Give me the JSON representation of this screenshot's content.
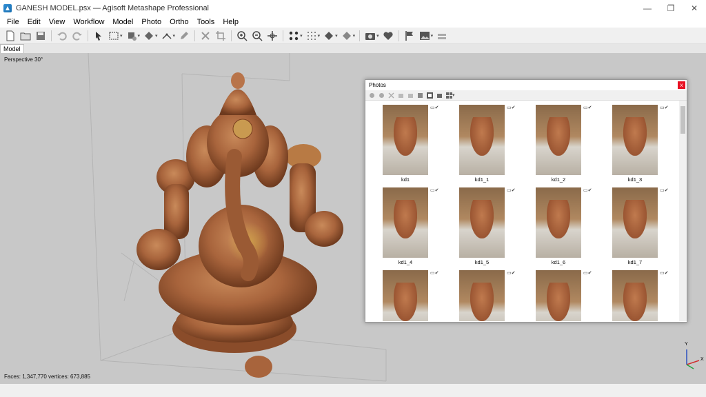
{
  "window": {
    "title": "GANESH MODEL.psx — Agisoft Metashape Professional",
    "controls": [
      "—",
      "❐",
      "✕"
    ]
  },
  "menu": [
    "File",
    "Edit",
    "View",
    "Workflow",
    "Model",
    "Photo",
    "Ortho",
    "Tools",
    "Help"
  ],
  "toolbar": {
    "icons": [
      "new-file-icon",
      "open-folder-icon",
      "save-icon",
      "undo-icon",
      "redo-icon",
      "pointer-icon",
      "rect-select-icon",
      "paint-icon",
      "fill-icon",
      "ruler-icon",
      "pencil-icon",
      "delete-icon",
      "crop-icon",
      "zoom-in-icon",
      "zoom-out-icon",
      "navigate-icon",
      "points-icon",
      "dots-grid-icon",
      "shape-icon",
      "shape-alt-icon",
      "camera-icon",
      "heart-icon",
      "flag-icon",
      "photo-icon",
      "stack-icon"
    ]
  },
  "tabs": {
    "model": "Model"
  },
  "viewport": {
    "view_label": "Perspective 30°",
    "status": "Faces: 1,347,770 vertices: 673,885",
    "axis": {
      "y": "Y",
      "x": "X"
    }
  },
  "photos_panel": {
    "title": "Photos",
    "close": "x",
    "photos": [
      {
        "label": "kd1"
      },
      {
        "label": "kd1_1"
      },
      {
        "label": "kd1_2"
      },
      {
        "label": "kd1_3"
      },
      {
        "label": "kd1_4"
      },
      {
        "label": "kd1_5"
      },
      {
        "label": "kd1_6"
      },
      {
        "label": "kd1_7"
      },
      {
        "label": ""
      },
      {
        "label": ""
      },
      {
        "label": ""
      },
      {
        "label": ""
      }
    ]
  },
  "colors": {
    "viewport_bg": "#c8c8c8",
    "statue": "#a8643c",
    "close_red": "#e81123"
  }
}
